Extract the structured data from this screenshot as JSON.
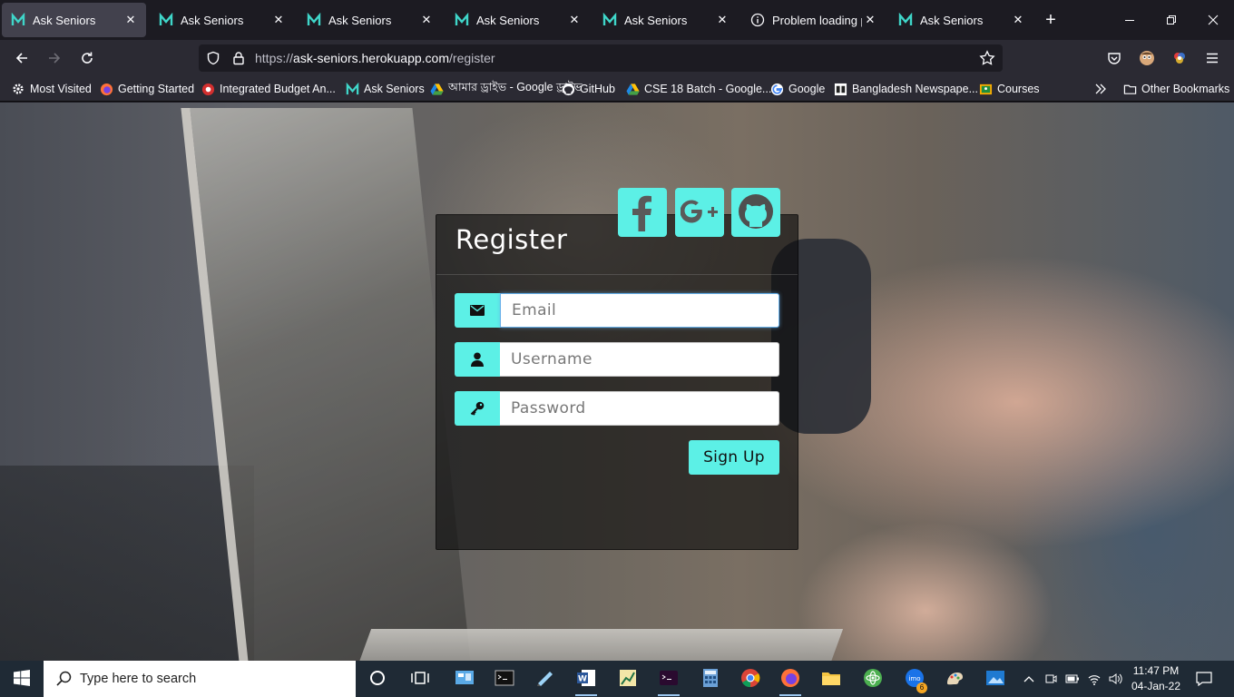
{
  "browser": {
    "tabs": [
      {
        "title": "Ask Seniors",
        "active": true,
        "favicon": "ask-seniors-icon"
      },
      {
        "title": "Ask Seniors",
        "active": false,
        "favicon": "ask-seniors-icon"
      },
      {
        "title": "Ask Seniors",
        "active": false,
        "favicon": "ask-seniors-icon"
      },
      {
        "title": "Ask Seniors",
        "active": false,
        "favicon": "ask-seniors-icon"
      },
      {
        "title": "Ask Seniors",
        "active": false,
        "favicon": "ask-seniors-icon"
      },
      {
        "title": "Problem loading page",
        "active": false,
        "favicon": "info-icon"
      },
      {
        "title": "Ask Seniors",
        "active": false,
        "favicon": "ask-seniors-icon"
      }
    ],
    "url": {
      "prefix": "https://",
      "host": "ask-seniors.herokuapp.com",
      "path": "/register"
    },
    "bookmarks": [
      {
        "label": "Most Visited",
        "icon": "gear-icon"
      },
      {
        "label": "Getting Started",
        "icon": "firefox-icon"
      },
      {
        "label": "Integrated Budget An...",
        "icon": "budget-icon"
      },
      {
        "label": "Ask Seniors",
        "icon": "ask-seniors-icon"
      },
      {
        "label": "আমার ড্রাইভ - Google ড্রাইভ",
        "icon": "google-drive-icon"
      },
      {
        "label": "GitHub",
        "icon": "github-icon"
      },
      {
        "label": "CSE 18 Batch - Google...",
        "icon": "google-drive-icon"
      },
      {
        "label": "Google",
        "icon": "google-icon"
      },
      {
        "label": "Bangladesh Newspape...",
        "icon": "newspaper-icon"
      },
      {
        "label": "Courses",
        "icon": "classroom-icon"
      }
    ],
    "other_bookmarks": "Other Bookmarks"
  },
  "page": {
    "title": "Register",
    "social": [
      "facebook-icon",
      "google-plus-icon",
      "github-icon"
    ],
    "fields": {
      "email": {
        "placeholder": "Email",
        "value": ""
      },
      "username": {
        "placeholder": "Username",
        "value": ""
      },
      "password": {
        "placeholder": "Password",
        "value": ""
      }
    },
    "submit_label": "Sign Up",
    "accent_color": "#5cf0e6"
  },
  "taskbar": {
    "search_placeholder": "Type here to search",
    "time": "11:47 PM",
    "date": "04-Jan-22",
    "imo_badge": "6"
  }
}
